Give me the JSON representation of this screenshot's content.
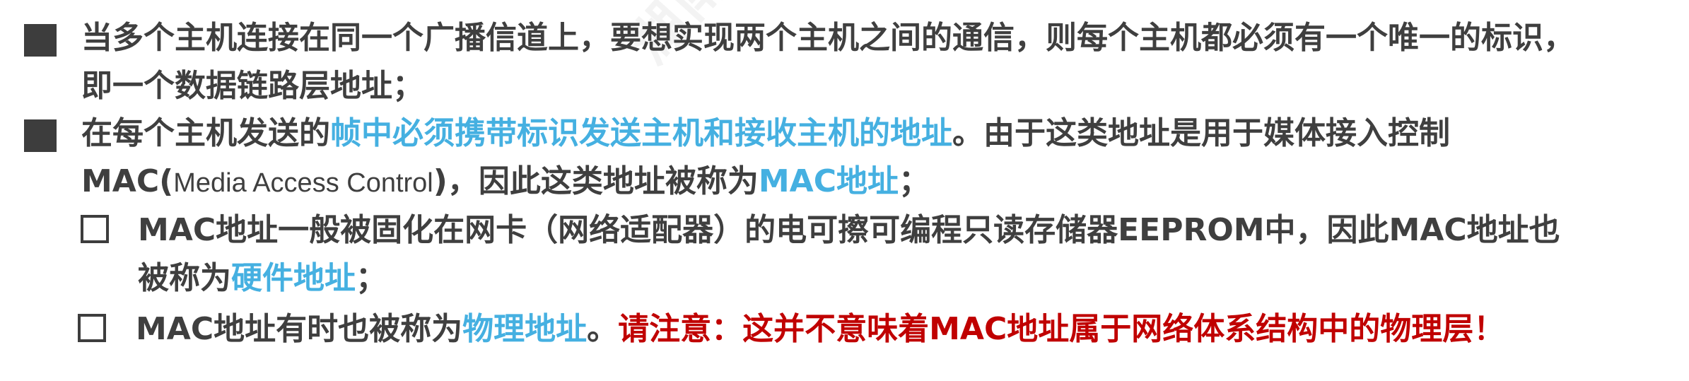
{
  "watermark": "湖南大学 书 uoc.bnu.edu.cn",
  "bullets": {
    "p1": {
      "line1": "当多个主机连接在同一个广播信道上，要想实现两个主机之间的通信，则每个主机都必须有一个唯一的标识，",
      "line2": "即一个数据链路层地址；"
    },
    "p2": {
      "line1_pre": "在每个主机发送的",
      "line1_highlight": "帧中必须携带标识发送主机和接收主机的地址",
      "line1_post": "。由于这类地址是用于媒体接入控制",
      "line2_mac": "MAC(",
      "line2_light": "Media Access Control",
      "line2_mid": ")，因此这类地址被称为",
      "line2_highlight": "MAC地址",
      "line2_end": "；"
    },
    "s1": {
      "line1": "MAC地址一般被固化在网卡（网络适配器）的电可擦可编程只读存储器EEPROM中，因此MAC地址也",
      "line2_pre": "被称为",
      "line2_highlight": "硬件地址",
      "line2_end": "；"
    },
    "s2": {
      "pre": "MAC地址有时也被称为",
      "highlight": "物理地址",
      "period": "。",
      "warning": "请注意：这并不意味着MAC地址属于网络体系结构中的物理层！"
    }
  },
  "colors": {
    "text": "#3f3f3f",
    "highlight_blue": "#45b0e1",
    "warning_red": "#c00000"
  }
}
